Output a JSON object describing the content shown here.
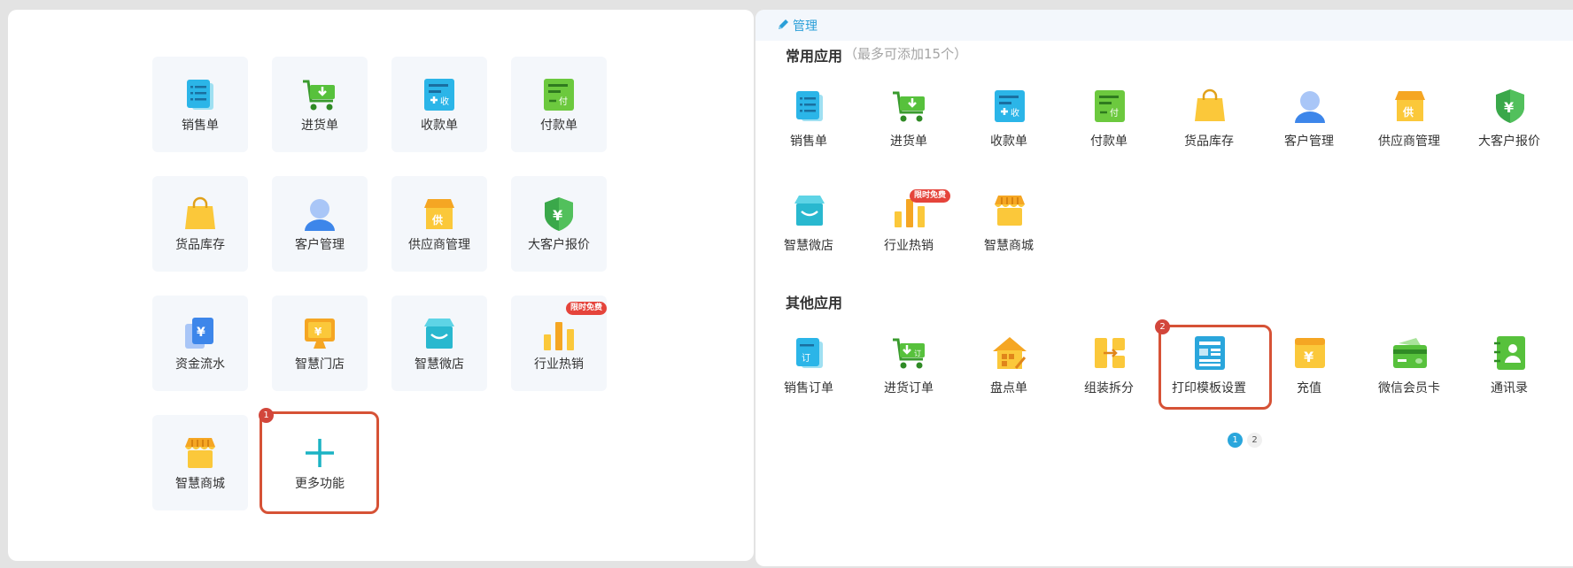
{
  "left_panel": {
    "tiles": [
      {
        "label": "销售单",
        "icon": "sales-order-icon"
      },
      {
        "label": "进货单",
        "icon": "purchase-cart-icon"
      },
      {
        "label": "收款单",
        "icon": "receipt-icon"
      },
      {
        "label": "付款单",
        "icon": "payment-icon"
      },
      {
        "label": "货品库存",
        "icon": "inventory-bag-icon"
      },
      {
        "label": "客户管理",
        "icon": "customer-icon"
      },
      {
        "label": "供应商管理",
        "icon": "supplier-store-icon"
      },
      {
        "label": "大客户报价",
        "icon": "yen-shield-icon"
      },
      {
        "label": "资金流水",
        "icon": "cash-flow-icon"
      },
      {
        "label": "智慧门店",
        "icon": "smart-store-monitor-icon"
      },
      {
        "label": "智慧微店",
        "icon": "micro-shop-icon"
      },
      {
        "label": "行业热销",
        "icon": "bar-chart-icon",
        "badge": "限时免费"
      },
      {
        "label": "智慧商城",
        "icon": "mall-icon"
      }
    ],
    "more_button": {
      "label": "更多功能",
      "step": "1"
    }
  },
  "right_panel": {
    "header": {
      "title": "管理"
    },
    "common": {
      "title": "常用应用",
      "hint": "（最多可添加15个）",
      "apps": [
        {
          "label": "销售单",
          "icon": "sales-order-icon"
        },
        {
          "label": "进货单",
          "icon": "purchase-cart-icon"
        },
        {
          "label": "收款单",
          "icon": "receipt-icon"
        },
        {
          "label": "付款单",
          "icon": "payment-icon"
        },
        {
          "label": "货品库存",
          "icon": "inventory-bag-icon"
        },
        {
          "label": "客户管理",
          "icon": "customer-icon"
        },
        {
          "label": "供应商管理",
          "icon": "supplier-store-icon"
        },
        {
          "label": "大客户报价",
          "icon": "yen-shield-icon"
        },
        {
          "label": "智慧微店",
          "icon": "micro-shop-icon"
        },
        {
          "label": "行业热销",
          "icon": "bar-chart-icon",
          "badge": "限时免费"
        },
        {
          "label": "智慧商城",
          "icon": "mall-icon"
        }
      ]
    },
    "other": {
      "title": "其他应用",
      "apps": [
        {
          "label": "销售订单",
          "icon": "sales-order-doc-icon"
        },
        {
          "label": "进货订单",
          "icon": "purchase-order-cart-icon"
        },
        {
          "label": "盘点单",
          "icon": "stocktake-house-icon"
        },
        {
          "label": "组装拆分",
          "icon": "assemble-split-icon"
        },
        {
          "label": "打印模板设置",
          "icon": "print-template-icon",
          "step": "2"
        },
        {
          "label": "充值",
          "icon": "recharge-yen-icon"
        },
        {
          "label": "微信会员卡",
          "icon": "member-card-icon"
        },
        {
          "label": "通讯录",
          "icon": "contacts-book-icon"
        }
      ]
    },
    "pagination": {
      "pages": [
        "1",
        "2"
      ],
      "current": "1"
    }
  },
  "colors": {
    "accent_blue": "#2a9fd8",
    "highlight_red": "#d65236",
    "tile_bg": "#f4f7fb",
    "plus_teal": "#1bb3c4"
  }
}
